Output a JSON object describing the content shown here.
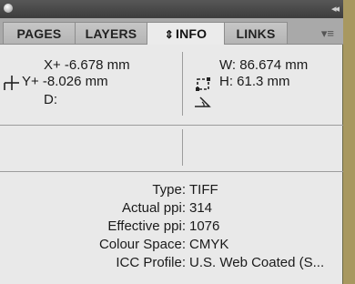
{
  "tabs": [
    {
      "label": "PAGES",
      "active": false
    },
    {
      "label": "LAYERS",
      "active": false
    },
    {
      "label": "INFO",
      "active": true,
      "prefix": "⇕"
    },
    {
      "label": "LINKS",
      "active": false
    }
  ],
  "position": {
    "x": "X+ -6.678 mm",
    "y": "Y+ -8.026 mm",
    "d": "D:"
  },
  "size": {
    "w": "W: 86.674 mm",
    "h": "H: 61.3 mm"
  },
  "image_info": [
    {
      "label": "Type:",
      "value": "TIFF"
    },
    {
      "label": "Actual ppi:",
      "value": "314"
    },
    {
      "label": "Effective ppi:",
      "value": "1076"
    },
    {
      "label": "Colour Space:",
      "value": "CMYK"
    },
    {
      "label": "ICC Profile:",
      "value": "U.S. Web Coated (S..."
    }
  ],
  "icons": {
    "cross": "crosshair-icon",
    "size": "bounding-box-icon",
    "angle": "angle-icon",
    "menu": "panel-menu-icon"
  },
  "colors": {
    "background": "#a89860",
    "panel": "#e9e9e9",
    "tabbar": "#a9a9a9",
    "titlebar": "#474747"
  }
}
